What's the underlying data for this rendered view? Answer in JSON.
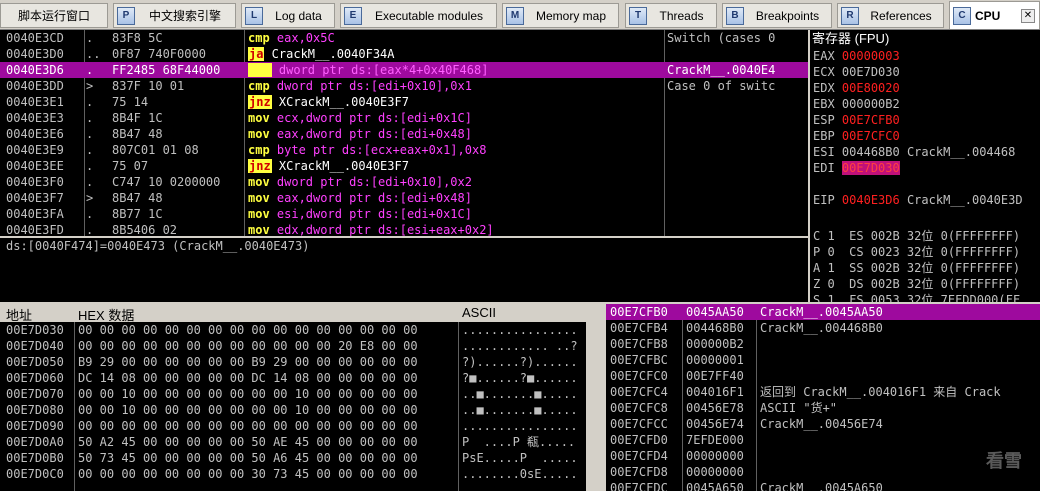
{
  "tabs": [
    {
      "icon": "",
      "label": "脚本运行窗口"
    },
    {
      "icon": "P",
      "label": "中文搜索引擎"
    },
    {
      "icon": "L",
      "label": "Log data"
    },
    {
      "icon": "E",
      "label": "Executable modules"
    },
    {
      "icon": "M",
      "label": "Memory map"
    },
    {
      "icon": "T",
      "label": "Threads"
    },
    {
      "icon": "B",
      "label": "Breakpoints"
    },
    {
      "icon": "R",
      "label": "References"
    },
    {
      "icon": "C",
      "label": "CPU"
    }
  ],
  "disasm": [
    {
      "addr": "0040E3CD",
      "mark": ".",
      "hex": "83F8 5C",
      "mnem": "cmp",
      "args": " eax,0x5C",
      "cmt": "Switch (cases 0"
    },
    {
      "addr": "0040E3D0",
      "mark": "..",
      "hex": "0F87 740F0000",
      "mnem": "ja",
      "args": " CrackM__.0040F34A",
      "cmt": ""
    },
    {
      "addr": "0040E3D6",
      "mark": ".",
      "hex": "FF2485 68F44000",
      "mnem": "jmp",
      "args": " dword ptr ds:[eax*4+0x40F468]",
      "cmt": "CrackM__.0040E4"
    },
    {
      "addr": "0040E3DD",
      "mark": ">",
      "hex": "837F 10 01",
      "mnem": "cmp",
      "args": " dword ptr ds:[edi+0x10],0x1",
      "cmt": "Case 0 of switc"
    },
    {
      "addr": "0040E3E1",
      "mark": ".",
      "hex": "75 14",
      "mnem": "jnz",
      "args": " XCrackM__.0040E3F7",
      "cmt": ""
    },
    {
      "addr": "0040E3E3",
      "mark": ".",
      "hex": "8B4F 1C",
      "mnem": "mov",
      "args": " ecx,dword ptr ds:[edi+0x1C]",
      "cmt": ""
    },
    {
      "addr": "0040E3E6",
      "mark": ".",
      "hex": "8B47 48",
      "mnem": "mov",
      "args": " eax,dword ptr ds:[edi+0x48]",
      "cmt": ""
    },
    {
      "addr": "0040E3E9",
      "mark": ".",
      "hex": "807C01 01 08",
      "mnem": "cmp",
      "args": " byte ptr ds:[ecx+eax+0x1],0x8",
      "cmt": ""
    },
    {
      "addr": "0040E3EE",
      "mark": ".",
      "hex": "75 07",
      "mnem": "jnz",
      "args": " XCrackM__.0040E3F7",
      "cmt": ""
    },
    {
      "addr": "0040E3F0",
      "mark": ".",
      "hex": "C747 10 0200000",
      "mnem": "mov",
      "args": " dword ptr ds:[edi+0x10],0x2",
      "cmt": ""
    },
    {
      "addr": "0040E3F7",
      "mark": ">",
      "hex": "8B47 48",
      "mnem": "mov",
      "args": " eax,dword ptr ds:[edi+0x48]",
      "cmt": ""
    },
    {
      "addr": "0040E3FA",
      "mark": ".",
      "hex": "8B77 1C",
      "mnem": "mov",
      "args": " esi,dword ptr ds:[edi+0x1C]",
      "cmt": ""
    },
    {
      "addr": "0040E3FD",
      "mark": ".",
      "hex": "8B5406 02",
      "mnem": "mov",
      "args": " edx,dword ptr ds:[esi+eax+0x2]",
      "cmt": ""
    }
  ],
  "info_line": "ds:[0040F474]=0040E473 (CrackM__.0040E473)",
  "registers_title": "寄存器 (FPU)",
  "registers": [
    {
      "name": "EAX",
      "val": "00000003",
      "extra": "",
      "color": "red"
    },
    {
      "name": "ECX",
      "val": "00E7D030",
      "extra": "",
      "color": ""
    },
    {
      "name": "EDX",
      "val": "00E80020",
      "extra": "",
      "color": "red"
    },
    {
      "name": "EBX",
      "val": "000000B2",
      "extra": "",
      "color": ""
    },
    {
      "name": "ESP",
      "val": "00E7CFB0",
      "extra": "",
      "color": "red"
    },
    {
      "name": "EBP",
      "val": "00E7CFC0",
      "extra": "",
      "color": "red"
    },
    {
      "name": "ESI",
      "val": "004468B0",
      "extra": "CrackM__.004468",
      "color": ""
    },
    {
      "name": "EDI",
      "val": "00E7D030",
      "extra": "",
      "color": "redbg"
    },
    {
      "name": "",
      "val": "",
      "extra": "",
      "color": ""
    },
    {
      "name": "EIP",
      "val": "0040E3D6",
      "extra": "CrackM__.0040E3D",
      "color": "red"
    },
    {
      "name": "",
      "val": "",
      "extra": "",
      "color": ""
    }
  ],
  "flags": [
    "C 1  ES 002B 32位 0(FFFFFFFF)",
    "P 0  CS 0023 32位 0(FFFFFFFF)",
    "A 1  SS 002B 32位 0(FFFFFFFF)",
    "Z 0  DS 002B 32位 0(FFFFFFFF)",
    "S 1  FS 0053 32位 7EFDD000(FF",
    "T 0  GS 002B 32位 0(FFFFFFFF)"
  ],
  "dump_header": {
    "addr": "地址",
    "hex": "HEX 数据",
    "ascii": "ASCII"
  },
  "dump": [
    {
      "addr": "00E7D030",
      "hex": "00 00 00 00 00 00 00 00 00 00 00 00 00 00 00 00",
      "ascii": "................"
    },
    {
      "addr": "00E7D040",
      "hex": "00 00 00 00 00 00 00 00 00 00 00 00 20 E8 00 00",
      "ascii": "............ ..?"
    },
    {
      "addr": "00E7D050",
      "hex": "B9 29 00 00 00 00 00 00 B9 29 00 00 00 00 00 00",
      "ascii": "?)......?)......"
    },
    {
      "addr": "00E7D060",
      "hex": "DC 14 08 00 00 00 00 00 DC 14 08 00 00 00 00 00",
      "ascii": "?■......?■......"
    },
    {
      "addr": "00E7D070",
      "hex": "00 00 10 00 00 00 00 00 00 00 10 00 00 00 00 00",
      "ascii": "..■.......■....."
    },
    {
      "addr": "00E7D080",
      "hex": "00 00 10 00 00 00 00 00 00 00 10 00 00 00 00 00",
      "ascii": "..■.......■....."
    },
    {
      "addr": "00E7D090",
      "hex": "00 00 00 00 00 00 00 00 00 00 00 00 00 00 00 00",
      "ascii": "................"
    },
    {
      "addr": "00E7D0A0",
      "hex": "50 A2 45 00 00 00 00 00 50 AE 45 00 00 00 00 00",
      "ascii": "P  ....P 瓻....."
    },
    {
      "addr": "00E7D0B0",
      "hex": "50 73 45 00 00 00 00 00 50 A6 45 00 00 00 00 00",
      "ascii": "PsE.....P  ....."
    },
    {
      "addr": "00E7D0C0",
      "hex": "00 00 00 00 00 00 00 00 30 73 45 00 00 00 00 00",
      "ascii": "........0sE....."
    }
  ],
  "stack": [
    {
      "addr": "00E7CFB0",
      "val": "0045AA50",
      "cmt": "CrackM__.0045AA50"
    },
    {
      "addr": "00E7CFB4",
      "val": "004468B0",
      "cmt": "CrackM__.004468B0"
    },
    {
      "addr": "00E7CFB8",
      "val": "000000B2",
      "cmt": ""
    },
    {
      "addr": "00E7CFBC",
      "val": "00000001",
      "cmt": ""
    },
    {
      "addr": "00E7CFC0",
      "val": "00E7FF40",
      "cmt": ""
    },
    {
      "addr": "00E7CFC4",
      "val": "004016F1",
      "cmt": "返回到 CrackM__.004016F1 来自 Crack"
    },
    {
      "addr": "00E7CFC8",
      "val": "00456E78",
      "cmt": "ASCII \"货+\""
    },
    {
      "addr": "00E7CFCC",
      "val": "00456E74",
      "cmt": "CrackM__.00456E74"
    },
    {
      "addr": "00E7CFD0",
      "val": "7EFDE000",
      "cmt": ""
    },
    {
      "addr": "00E7CFD4",
      "val": "00000000",
      "cmt": ""
    },
    {
      "addr": "00E7CFD8",
      "val": "00000000",
      "cmt": ""
    },
    {
      "addr": "00E7CFDC",
      "val": "0045A650",
      "cmt": "CrackM__.0045A650"
    }
  ],
  "watermark": "看雪"
}
